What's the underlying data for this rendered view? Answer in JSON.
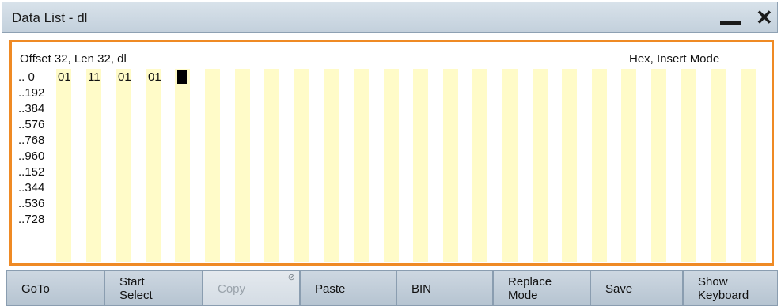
{
  "window": {
    "title": "Data List - dl",
    "minimize_icon": "minimize-icon",
    "close_glyph": "✕"
  },
  "editor": {
    "info_left": "Offset 32, Len 32,   dl",
    "info_right": "Hex, Insert Mode",
    "row_labels": [
      "..   0",
      "..192",
      "..384",
      "..576",
      "..768",
      "..960",
      "..152",
      "..344",
      "..536",
      "..728"
    ],
    "first_row_bytes": [
      "01",
      "11",
      "01",
      "01"
    ],
    "highlight_color": "#fffbc8",
    "border_color": "#ef8a24"
  },
  "softkeys": [
    {
      "label": "GoTo",
      "enabled": true
    },
    {
      "label": "Start\nSelect",
      "enabled": true
    },
    {
      "label": "Copy",
      "enabled": false
    },
    {
      "label": "Paste",
      "enabled": true
    },
    {
      "label": "BIN",
      "enabled": true
    },
    {
      "label": "Replace\nMode",
      "enabled": true
    },
    {
      "label": "Save",
      "enabled": true
    },
    {
      "label": "Show\nKeyboard",
      "enabled": true
    }
  ]
}
